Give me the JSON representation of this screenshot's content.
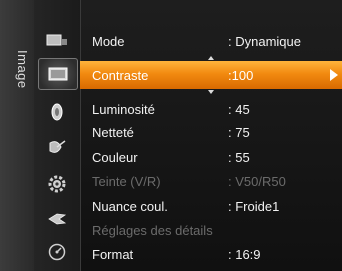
{
  "menu": {
    "section_title": "Image",
    "items": [
      {
        "label": "Mode",
        "value": ": Dynamique"
      },
      {
        "label": "Contraste",
        "value": ":100"
      },
      {
        "label": "Luminosité",
        "value": ": 45"
      },
      {
        "label": "Netteté",
        "value": ": 75"
      },
      {
        "label": "Couleur",
        "value": ": 55"
      },
      {
        "label": "Teinte (V/R)",
        "value": ": V50/R50"
      },
      {
        "label": "Nuance coul.",
        "value": ": Froide1"
      },
      {
        "label": "Réglages des détails",
        "value": ""
      },
      {
        "label": "Format",
        "value": ": 16:9"
      }
    ],
    "selected_index": 1,
    "disabled_items": [
      "Teinte (V/R)",
      "Réglages des détails"
    ]
  },
  "icons": [
    "input-icon",
    "picture-icon",
    "sound-icon",
    "channel-icon",
    "setup-icon",
    "input-source-icon",
    "support-icon"
  ],
  "colors": {
    "highlight": "#f28a10",
    "text": "#f2f2f2",
    "disabled_text": "#6b6b6b"
  }
}
